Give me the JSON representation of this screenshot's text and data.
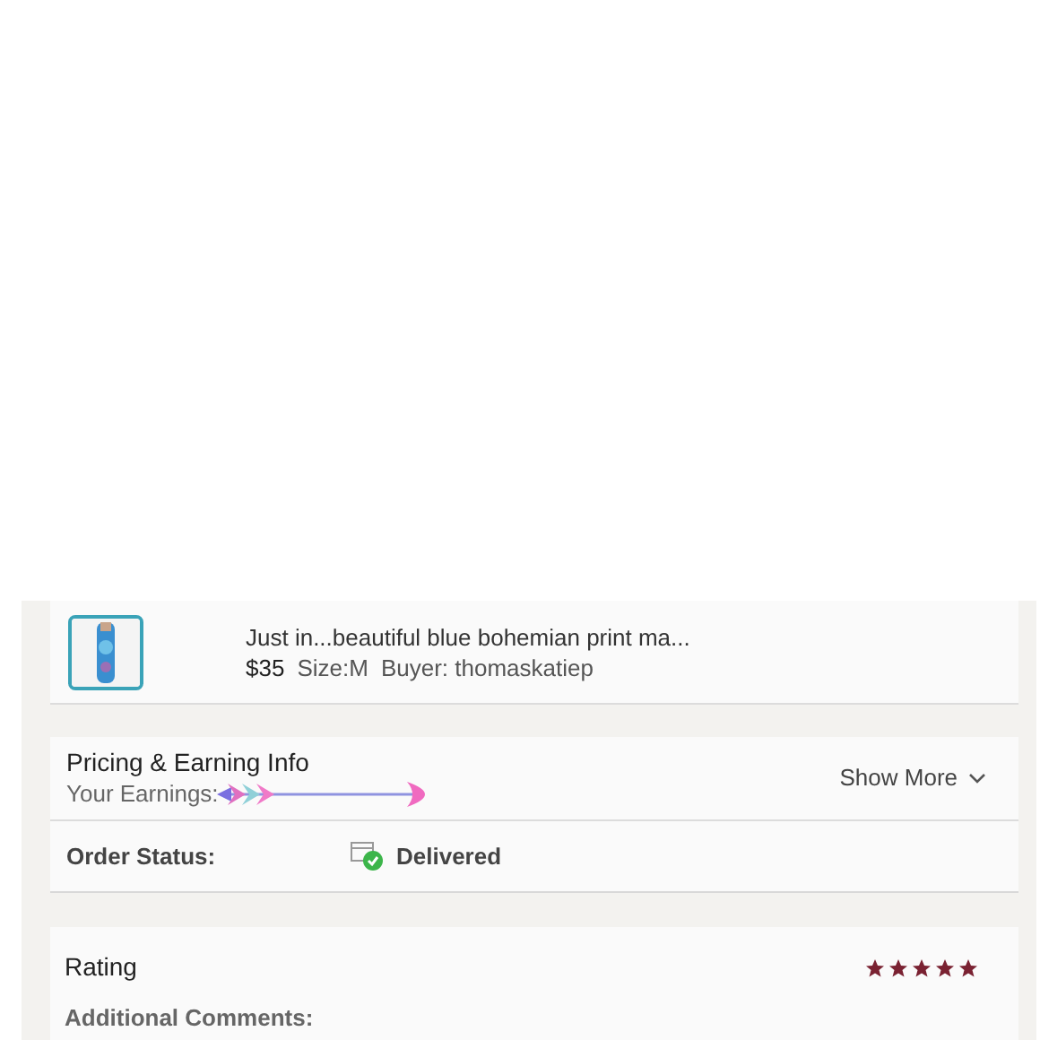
{
  "item": {
    "title": "Just in...beautiful blue bohemian print ma...",
    "price": "$35",
    "size": "Size:M",
    "buyer": "Buyer: thomaskatiep"
  },
  "pricing": {
    "title": "Pricing & Earning Info",
    "earnings_label": "Your Earnings:",
    "toggle": "Show More"
  },
  "order_status": {
    "label": "Order Status:",
    "value": "Delivered"
  },
  "rating": {
    "title": "Rating",
    "stars": 5,
    "comments_label": "Additional Comments:"
  }
}
